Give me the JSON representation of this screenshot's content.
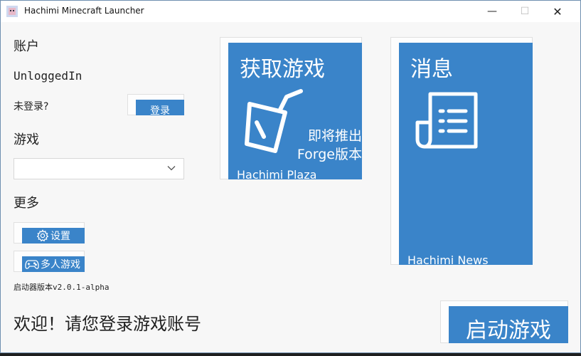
{
  "window": {
    "title": "Hachimi Minecraft Launcher",
    "controls": {
      "minimize": "—",
      "maximize": "☐",
      "close": "✕"
    }
  },
  "account": {
    "heading": "账户",
    "username": "UnloggedIn",
    "not_logged_prompt": "未登录?",
    "login_label": "登录"
  },
  "game": {
    "heading": "游戏",
    "selected_version": ""
  },
  "more": {
    "heading": "更多",
    "settings_label": "设置",
    "multiplayer_label": "多人游戏"
  },
  "version_text": "启动器版本v2.0.1-alpha",
  "welcome_text": "欢迎！请您登录游戏账号",
  "tiles": {
    "plaza": {
      "title": "获取游戏",
      "coming_soon_line1": "即将推出",
      "coming_soon_line2": "Forge版本",
      "footer": "Hachimi Plaza",
      "icon": "drink-cup-icon"
    },
    "news": {
      "title": "消息",
      "footer": "Hachimi News",
      "icon": "newspaper-icon"
    }
  },
  "launch_label": "启动游戏",
  "colors": {
    "accent": "#3a84c9",
    "background": "#f7f7f7",
    "frame": "#1f1f1f"
  }
}
